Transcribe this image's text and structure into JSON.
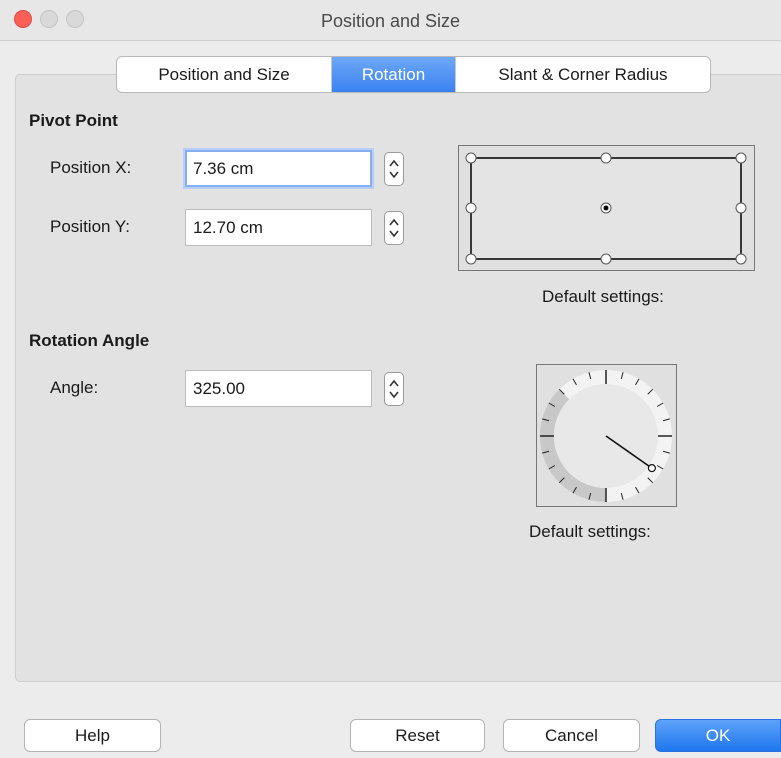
{
  "window": {
    "title": "Position and Size"
  },
  "tabs": [
    {
      "label": "Position and Size",
      "active": false
    },
    {
      "label": "Rotation",
      "active": true
    },
    {
      "label": "Slant & Corner Radius",
      "active": false
    }
  ],
  "pivot": {
    "heading": "Pivot Point",
    "x_label": "Position X:",
    "x_value": "7.36 cm",
    "y_label": "Position Y:",
    "y_value": "12.70 cm",
    "default_label": "Default settings:"
  },
  "rotation": {
    "heading": "Rotation Angle",
    "angle_label": "Angle:",
    "angle_value": "325.00",
    "angle_degrees": 325,
    "default_label": "Default settings:"
  },
  "buttons": {
    "help": "Help",
    "reset": "Reset",
    "cancel": "Cancel",
    "ok": "OK"
  },
  "colors": {
    "accent": "#3a82f1",
    "close": "#fc5f57"
  }
}
